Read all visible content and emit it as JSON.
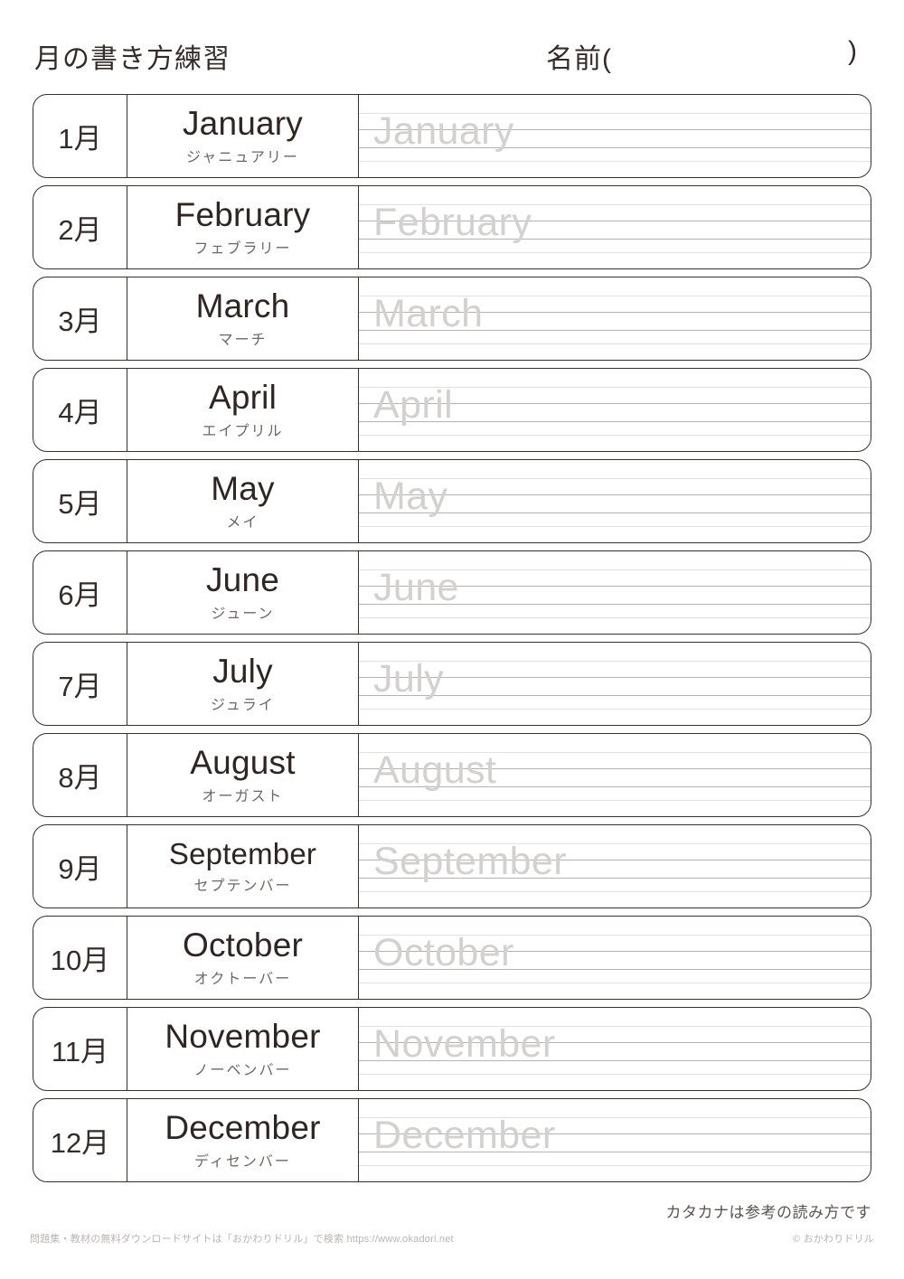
{
  "header": {
    "title": "月の書き方練習",
    "name_label": "名前(",
    "name_paren_close": ")"
  },
  "rows": [
    {
      "number": "1月",
      "english": "January",
      "kana": "ジャニュアリー",
      "trace": "January"
    },
    {
      "number": "2月",
      "english": "February",
      "kana": "フェブラリー",
      "trace": "February"
    },
    {
      "number": "3月",
      "english": "March",
      "kana": "マーチ",
      "trace": "March"
    },
    {
      "number": "4月",
      "english": "April",
      "kana": "エイプリル",
      "trace": "April"
    },
    {
      "number": "5月",
      "english": "May",
      "kana": "メイ",
      "trace": "May"
    },
    {
      "number": "6月",
      "english": "June",
      "kana": "ジューン",
      "trace": "June"
    },
    {
      "number": "7月",
      "english": "July",
      "kana": "ジュライ",
      "trace": "July"
    },
    {
      "number": "8月",
      "english": "August",
      "kana": "オーガスト",
      "trace": "August"
    },
    {
      "number": "9月",
      "english": "September",
      "kana": "セプテンバー",
      "trace": "September"
    },
    {
      "number": "10月",
      "english": "October",
      "kana": "オクトーバー",
      "trace": "October"
    },
    {
      "number": "11月",
      "english": "November",
      "kana": "ノーベンバー",
      "trace": "November"
    },
    {
      "number": "12月",
      "english": "December",
      "kana": "ディセンバー",
      "trace": "December"
    }
  ],
  "notes": {
    "katakana_note": "カタカナは参考の読み方です"
  },
  "footer": {
    "left": "問題集・教材の無料ダウンロードサイトは「おかわりドリル」で検索  https://www.okadori.net",
    "right": "© おかわりドリル"
  },
  "colors": {
    "border": "#3a2e2c",
    "text": "#2f2523",
    "kana": "#6e6764",
    "trace": "#d3d1d0",
    "guide_line_outer": "#e3e1e0",
    "guide_line_inner": "#b6b2b0",
    "footer": "#b9b5b3"
  }
}
